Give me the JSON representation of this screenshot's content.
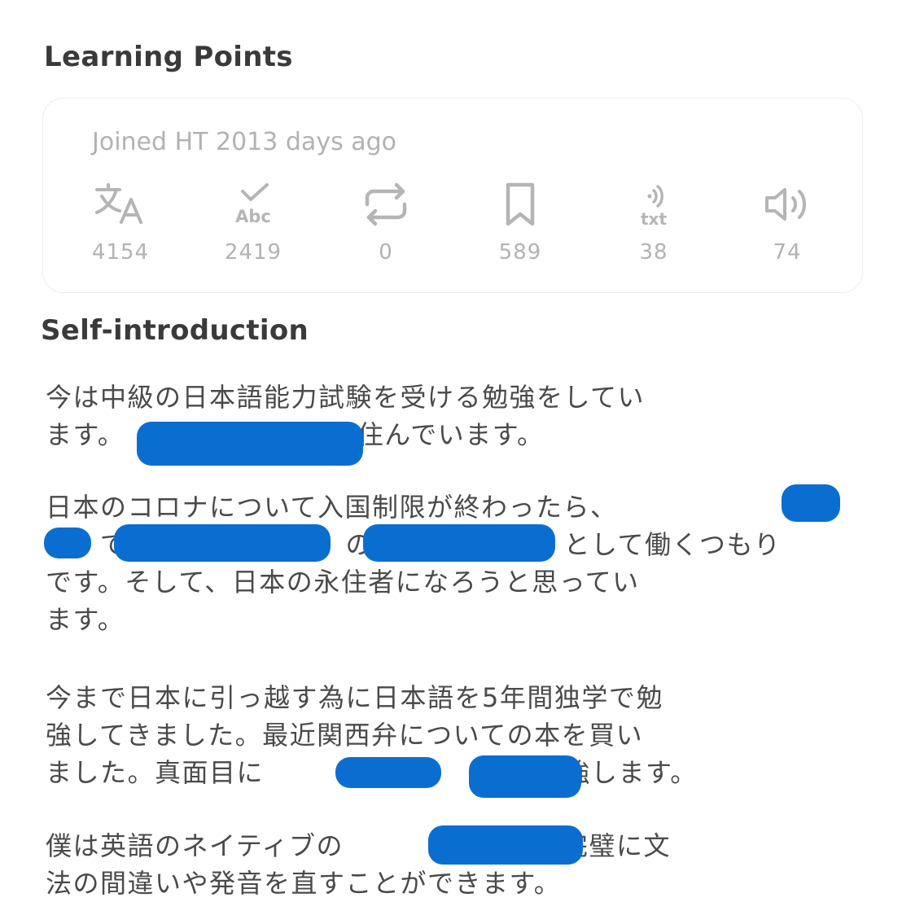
{
  "learning_points": {
    "title": "Learning Points",
    "joined": "Joined HT 2013 days ago",
    "stats": [
      {
        "icon": "translate-icon",
        "count": "4154"
      },
      {
        "icon": "grammar-check-icon",
        "count": "2419"
      },
      {
        "icon": "repeat-icon",
        "count": "0"
      },
      {
        "icon": "bookmark-icon",
        "count": "589"
      },
      {
        "icon": "voice-to-text-icon",
        "count": "38"
      },
      {
        "icon": "speaker-icon",
        "count": "74"
      }
    ]
  },
  "self_introduction": {
    "title": "Self-introduction",
    "paragraphs": [
      [
        "今は中級の日本語能力試験を受ける勉強をしてい",
        "ます。　　　　　　　　に住んでいます。"
      ],
      [
        "日本のコロナについて入国制限が終わったら、",
        "　　で　　　　　　　　の　　　　　　　として働くつもり",
        "です。そして、日本の永住者になろうと思ってい",
        "ます。"
      ],
      [
        "今まで日本に引っ越す為に日本語を5年間独学で勉",
        "強してきました。最近関西弁についての本を買い",
        "ました。真面目に　　　　と　　　　を勉強します。"
      ],
      [
        "僕は英語のネイティブの　　　　　なので完璧に文",
        "法の間違いや発音を直すことができます。"
      ]
    ]
  },
  "colors": {
    "redaction": "#0a6ed1",
    "muted_text": "#b2b2b2"
  }
}
